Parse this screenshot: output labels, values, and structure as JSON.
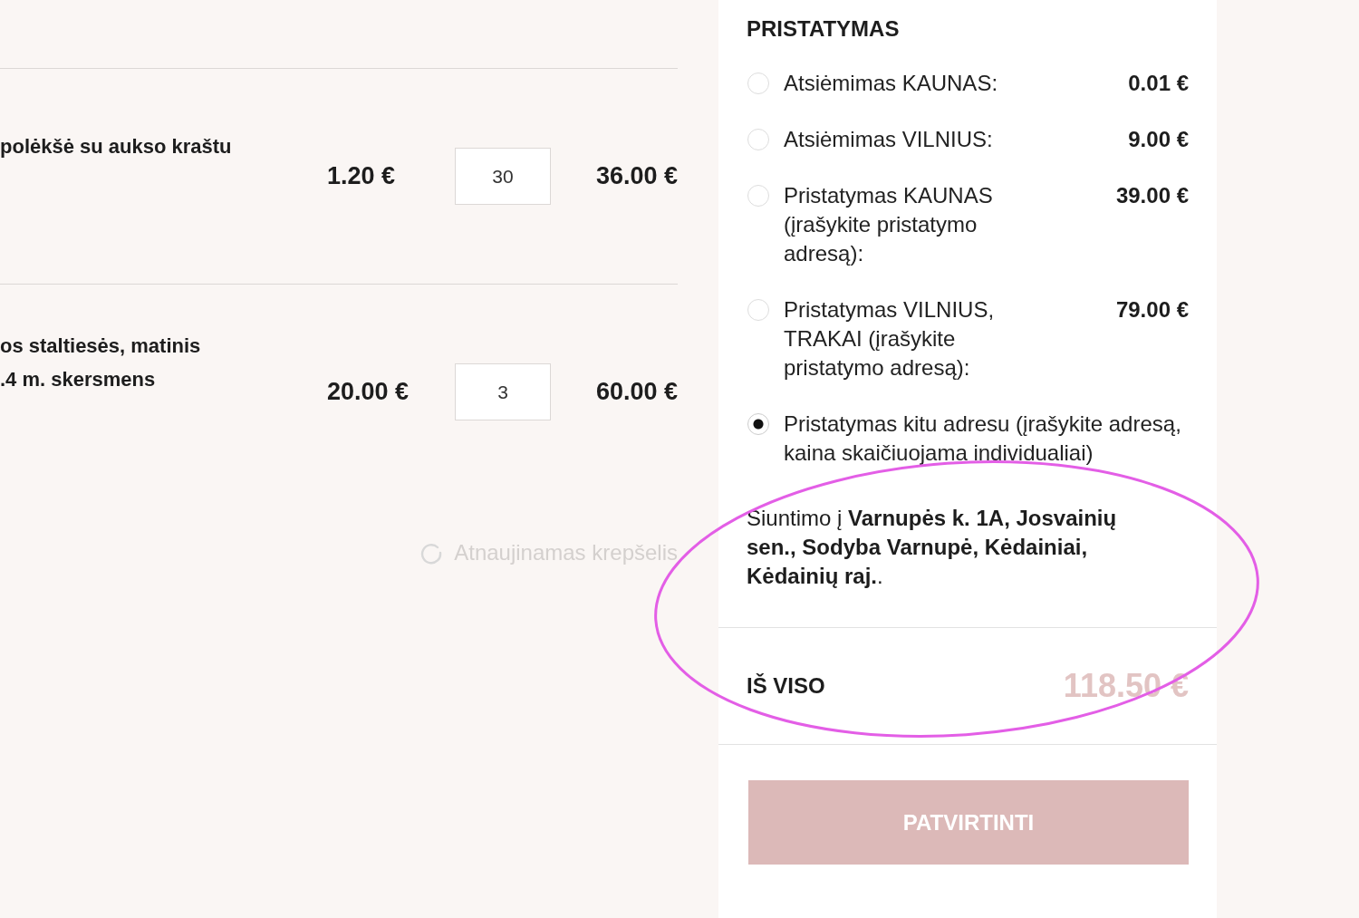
{
  "cart": {
    "items": [
      {
        "name_lines": [
          "polėkšė su aukso kraštu"
        ],
        "price": "1.20 €",
        "quantity": "30",
        "total": "36.00 €"
      },
      {
        "name_lines": [
          "os staltiesės, matinis",
          ".4 m. skersmens"
        ],
        "price": "20.00 €",
        "quantity": "3",
        "total": "60.00 €"
      }
    ],
    "updating_text": "Atnaujinamas krepšelis"
  },
  "delivery": {
    "title": "PRISTATYMAS",
    "options": [
      {
        "label": "Atsiėmimas KAUNAS:",
        "price": "0.01 €",
        "selected": false
      },
      {
        "label": "Atsiėmimas VILNIUS:",
        "price": "9.00 €",
        "selected": false
      },
      {
        "label": "Pristatymas KAUNAS (įrašykite pristatymo adresą):",
        "price": "39.00 €",
        "selected": false
      },
      {
        "label": "Pristatymas VILNIUS, TRAKAI (įrašykite pristatymo adresą):",
        "price": "79.00 €",
        "selected": false
      },
      {
        "label": "Pristatymas kitu adresu (įrašykite adresą, kaina skaičiuojama individualiai)",
        "selected": true
      }
    ],
    "shipping_note": "Siuntimo į **Varnupės k. 1A, Josvainių sen., Sodyba Varnupė, Kėdainiai, Kėdainių raj.**."
  },
  "total": {
    "label": "IŠ VISO",
    "value": "118.50 €"
  },
  "confirm_button": "PATVIRTINTI"
}
